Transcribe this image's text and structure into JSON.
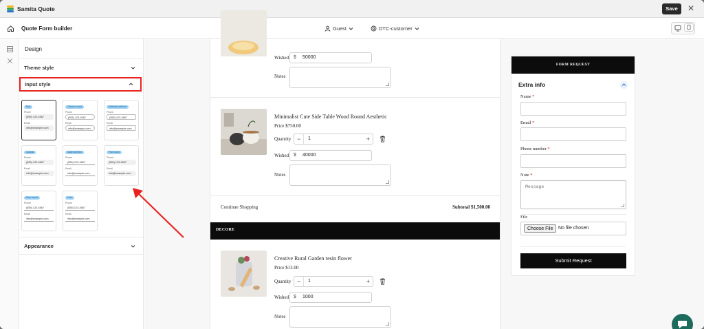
{
  "app": {
    "title": "Samita Quote",
    "save_label": "Save",
    "close_label": "✕"
  },
  "header": {
    "title": "Quote Form builder",
    "customer_select": "Guest",
    "customer_type_select": "DTC-customer"
  },
  "sidebar": {
    "heading": "Design",
    "sections": {
      "theme_style": "Theme style",
      "input_style": "Input style",
      "appearance": "Appearance"
    },
    "input_styles": [
      {
        "name": "Flat",
        "phone_label": "Phone",
        "phone_value": "(555) 123-4567",
        "email_label": "Email",
        "email_value": "info@example.com",
        "style": "st-flat",
        "active": true
      },
      {
        "name": "Classic round",
        "phone_label": "Phone",
        "phone_value": "(555) 123-4567",
        "email_label": "Email",
        "email_value": "info@example.com",
        "style": "st-pill"
      },
      {
        "name": "Material outlined",
        "phone_label": "Phone",
        "phone_value": "(555) 123-4567",
        "email_label": "Email",
        "email_value": "info@example.com",
        "style": "st-outline"
      },
      {
        "name": "Classic",
        "phone_label": "Phone",
        "phone_value": "(555) 123-4567",
        "email_label": "Email",
        "email_value": "info@example.com",
        "style": "st-flat"
      },
      {
        "name": "Material filled",
        "phone_label": "Phone",
        "phone_value": "(555) 123-4567",
        "email_label": "Email",
        "email_value": "info@example.com",
        "style": "st-underline"
      },
      {
        "name": "Flat round",
        "phone_label": "Phone",
        "phone_value": "(555) 123-4567",
        "email_label": "Email",
        "email_value": "info@example.com",
        "style": "st-rounded"
      },
      {
        "name": "Line round",
        "phone_label": "Phone",
        "phone_value": "(555) 123-4567",
        "email_label": "Email",
        "email_value": "info@example.com",
        "style": "st-underline"
      },
      {
        "name": "Line",
        "phone_label": "Phone",
        "phone_value": "(555) 123-4567",
        "email_label": "Email",
        "email_value": "info@example.com",
        "style": "st-underline"
      }
    ]
  },
  "cart": {
    "wished_price_label": "Wished price",
    "notes_label": "Notes",
    "quantity_label": "Quantity",
    "currency": "$",
    "items": [
      {
        "wished_price": "50000"
      },
      {
        "title": "Minimalist Cute Side Table Wood Round Aesthetic",
        "price": "Price  $750.00",
        "quantity": "1",
        "wished_price": "40000"
      },
      {
        "title": "Creative Rural Garden resin flower",
        "price": "Price  $13.00",
        "quantity": "1",
        "wished_price": "1000"
      }
    ],
    "continue_label": "Continue Shopping",
    "subtotal": "Subtotal $1,500.00",
    "section_title": "DECORE"
  },
  "form": {
    "header": "FORM REQUEST",
    "section_title": "Extra info",
    "fields": {
      "name": "Name",
      "email": "Email",
      "phone": "Phone number",
      "note": "Note",
      "note_placeholder": "Message",
      "file": "File"
    },
    "required_mark": "*",
    "file_button": "Choose File",
    "file_status": "No file chosen",
    "submit": "Submit Request"
  },
  "colors": {
    "accent": "#e8231f",
    "badge": "#9fd2f5",
    "dark": "#0c0c0c",
    "chat": "#1c6b5c"
  }
}
